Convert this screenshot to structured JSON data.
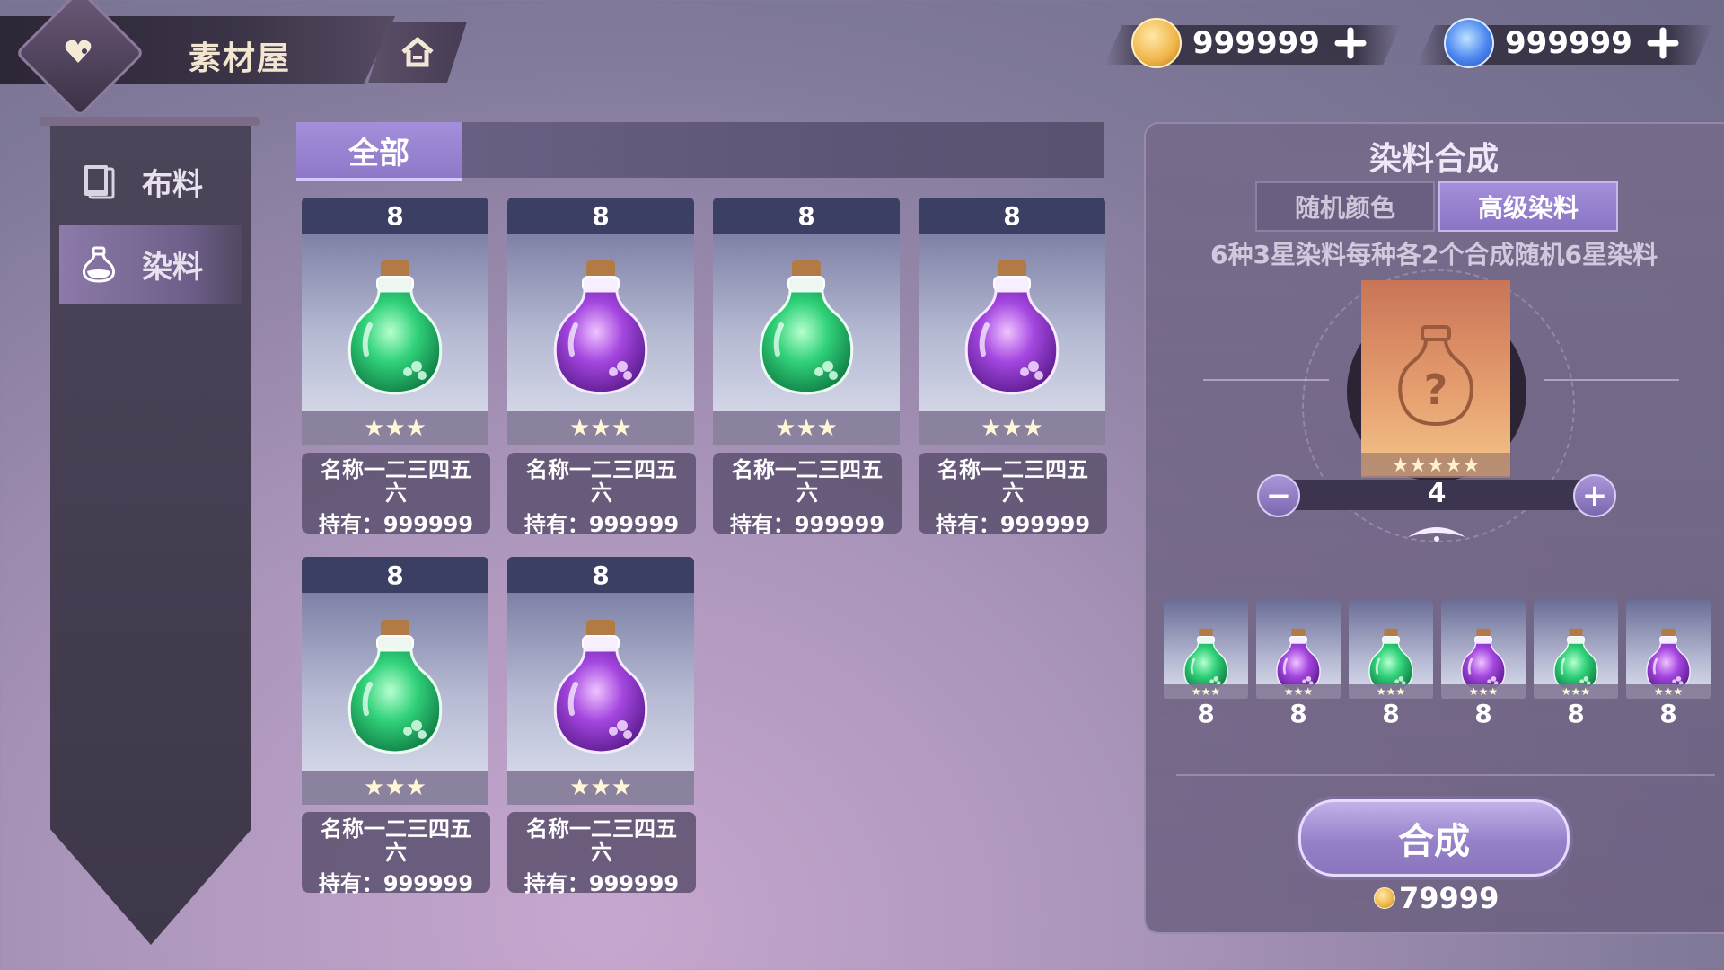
{
  "header": {
    "title": "素材屋",
    "gold": "999999",
    "gems": "999999"
  },
  "sidebar": {
    "items": [
      {
        "label": "布料",
        "icon": "book-icon",
        "active": false
      },
      {
        "label": "染料",
        "icon": "bottle-icon",
        "active": true
      }
    ]
  },
  "filter": {
    "tab_all": "全部"
  },
  "items": [
    {
      "count": "8",
      "name": "名称一二三四五六",
      "own": "持有：999999",
      "stars": "★★★",
      "color": "green"
    },
    {
      "count": "8",
      "name": "名称一二三四五六",
      "own": "持有：999999",
      "stars": "★★★",
      "color": "purple"
    },
    {
      "count": "8",
      "name": "名称一二三四五六",
      "own": "持有：999999",
      "stars": "★★★",
      "color": "green"
    },
    {
      "count": "8",
      "name": "名称一二三四五六",
      "own": "持有：999999",
      "stars": "★★★",
      "color": "purple"
    },
    {
      "count": "8",
      "name": "名称一二三四五六",
      "own": "持有：999999",
      "stars": "★★★",
      "color": "green"
    },
    {
      "count": "8",
      "name": "名称一二三四五六",
      "own": "持有：999999",
      "stars": "★★★",
      "color": "purple"
    }
  ],
  "synth": {
    "title": "染料合成",
    "tab_random": "随机颜色",
    "tab_advanced": "高级染料",
    "description": "6种3星染料每种各2个合成随机6星染料",
    "result_stars": "★★★★★",
    "result_question": "?",
    "quantity": "4",
    "minus": "−",
    "plus": "+",
    "materials": [
      {
        "count": "8",
        "stars": "★★★",
        "color": "green"
      },
      {
        "count": "8",
        "stars": "★★★",
        "color": "purple"
      },
      {
        "count": "8",
        "stars": "★★★",
        "color": "green"
      },
      {
        "count": "8",
        "stars": "★★★",
        "color": "purple"
      },
      {
        "count": "8",
        "stars": "★★★",
        "color": "green"
      },
      {
        "count": "8",
        "stars": "★★★",
        "color": "purple"
      }
    ],
    "craft_label": "合成",
    "cost": "79999"
  },
  "colors": {
    "green_potion": "#2fc46f",
    "purple_potion": "#9b3fd6",
    "accent": "#9b85d8"
  }
}
